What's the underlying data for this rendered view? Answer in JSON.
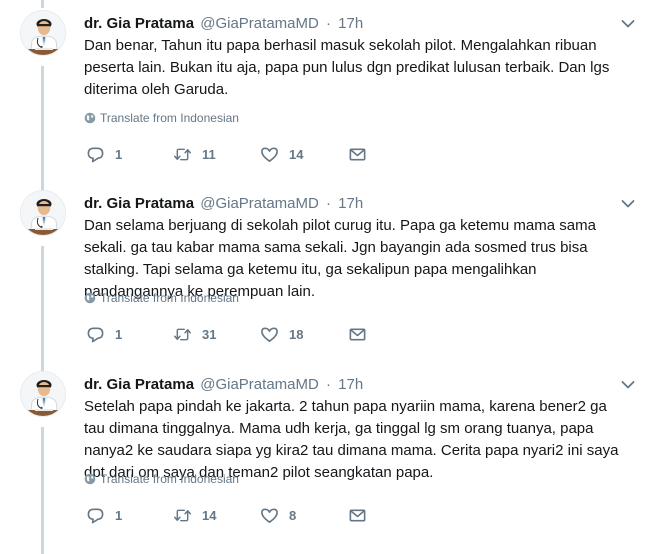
{
  "tweets": [
    {
      "author_name": "dr. Gia Pratama",
      "author_handle": "@GiaPratamaMD",
      "separator": "·",
      "time": "17h",
      "text_lines": [
        "Dan benar, Tahun itu papa berhasil masuk sekolah pilot. Mengalahkan ribuan",
        "peserta lain. Bukan itu aja, papa pun lulus dgn predikat lulusan terbaik. Dan lgs",
        "diterima oleh Garuda."
      ],
      "translate_label": "Translate from Indonesian",
      "replies": "1",
      "retweets": "11",
      "likes": "14"
    },
    {
      "author_name": "dr. Gia Pratama",
      "author_handle": "@GiaPratamaMD",
      "separator": "·",
      "time": "17h",
      "text_lines": [
        "Dan selama berjuang di sekolah pilot curug itu. Papa ga ketemu mama sama",
        "sekali.  ga tau kabar mama sama sekali. Jgn bayangin ada sosmed trus bisa",
        "stalking. Tapi selama ga ketemu itu, ga sekalipun papa mengalihkan",
        "pandangannya ke perempuan lain."
      ],
      "translate_label": "Translate from Indonesian",
      "replies": "1",
      "retweets": "31",
      "likes": "18"
    },
    {
      "author_name": "dr. Gia Pratama",
      "author_handle": "@GiaPratamaMD",
      "separator": "·",
      "time": "17h",
      "text_lines": [
        "Setelah papa pindah ke jakarta. 2 tahun papa nyariin mama, karena bener2 ga",
        "tau dimana tinggalnya. Mama udh kerja, ga tinggal lg sm orang tuanya, papa",
        "nanya2 ke saudara siapa yg kira2 tau dimana mama. Cerita papa nyari2 ini saya",
        "dpt dari om saya dan teman2 pilot seangkatan papa."
      ],
      "translate_label": "Translate from Indonesian",
      "replies": "1",
      "retweets": "14",
      "likes": "8"
    }
  ],
  "icons": {
    "avatar": "avatar-doctor",
    "caret": "chevron-down-icon",
    "translate": "globe-icon",
    "reply": "reply-icon",
    "retweet": "retweet-icon",
    "like": "heart-icon",
    "dm": "envelope-icon"
  },
  "colors": {
    "text": "#14171a",
    "secondary": "#657786",
    "thread_line": "#ccd6dd"
  }
}
